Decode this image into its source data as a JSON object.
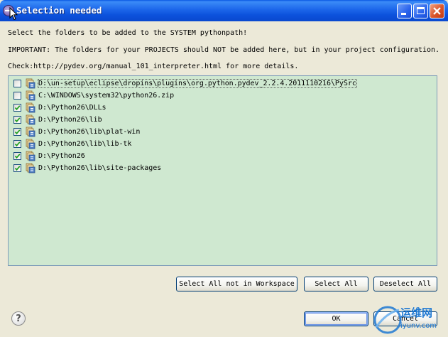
{
  "window": {
    "title": "Selection needed",
    "controls": [
      "minimize",
      "maximize",
      "close"
    ]
  },
  "messages": {
    "line1": "Select the folders to be added to the SYSTEM pythonpath!",
    "line2": "IMPORTANT: The folders for your PROJECTS should NOT be added here, but in your project configuration.",
    "line3": "Check:http://pydev.org/manual_101_interpreter.html for more details."
  },
  "folders": [
    {
      "path": "D:\\un-setup\\eclipse\\dropins\\plugins\\org.python.pydev_2.2.4.2011110216\\PySrc",
      "checked": false
    },
    {
      "path": "C:\\WINDOWS\\system32\\python26.zip",
      "checked": false
    },
    {
      "path": "D:\\Python26\\DLLs",
      "checked": true
    },
    {
      "path": "D:\\Python26\\lib",
      "checked": true
    },
    {
      "path": "D:\\Python26\\lib\\plat-win",
      "checked": true
    },
    {
      "path": "D:\\Python26\\lib\\lib-tk",
      "checked": true
    },
    {
      "path": "D:\\Python26",
      "checked": true
    },
    {
      "path": "D:\\Python26\\lib\\site-packages",
      "checked": true
    }
  ],
  "buttons": {
    "select_not_workspace": "Select All not in Workspace",
    "select_all": "Select All",
    "deselect_all": "Deselect All",
    "ok": "OK",
    "cancel": "Cancel",
    "help": "?"
  },
  "watermark": {
    "text": "运维网",
    "url": "iyunv.com"
  },
  "colors": {
    "titlebar": "#0a58e3",
    "list_background": "#cfe8d0",
    "dialog_background": "#ece9d8",
    "checkmark": "#21a121",
    "watermark": "#1e78d2"
  }
}
